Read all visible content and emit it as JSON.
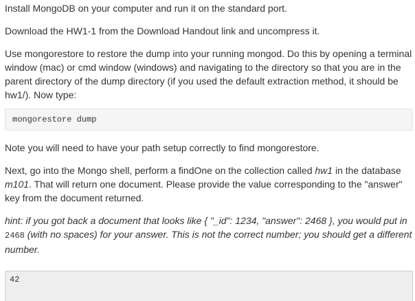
{
  "instructions": {
    "p1": "Install MongoDB on your computer and run it on the standard port.",
    "p2": "Download the HW1-1 from the Download Handout link and uncompress it.",
    "p3": "Use mongorestore to restore the dump into your running mongod. Do this by opening a terminal window (mac) or cmd window (windows) and navigating to the directory so that you are in the parent directory of the dump directory (if you used the default extraction method, it should be hw1/). Now type:",
    "command": "mongorestore dump",
    "p4": "Note you will need to have your path setup correctly to find mongorestore.",
    "p5_a": "Next, go into the Mongo shell, perform a findOne on the collection called ",
    "p5_collection": "hw1",
    "p5_b": " in the database ",
    "p5_database": "m101",
    "p5_c": ". That will return one document. Please provide the value corresponding to the \"answer\" key from the document returned.",
    "hint_a": "hint: if you got back a document that looks like { \"_id\": 1234, \"answer\": 2468 }, you would put in ",
    "hint_code": "2468",
    "hint_b": " (with no spaces) for your answer. This is not the correct number; you should get a different number."
  },
  "answer": {
    "value": "42"
  }
}
